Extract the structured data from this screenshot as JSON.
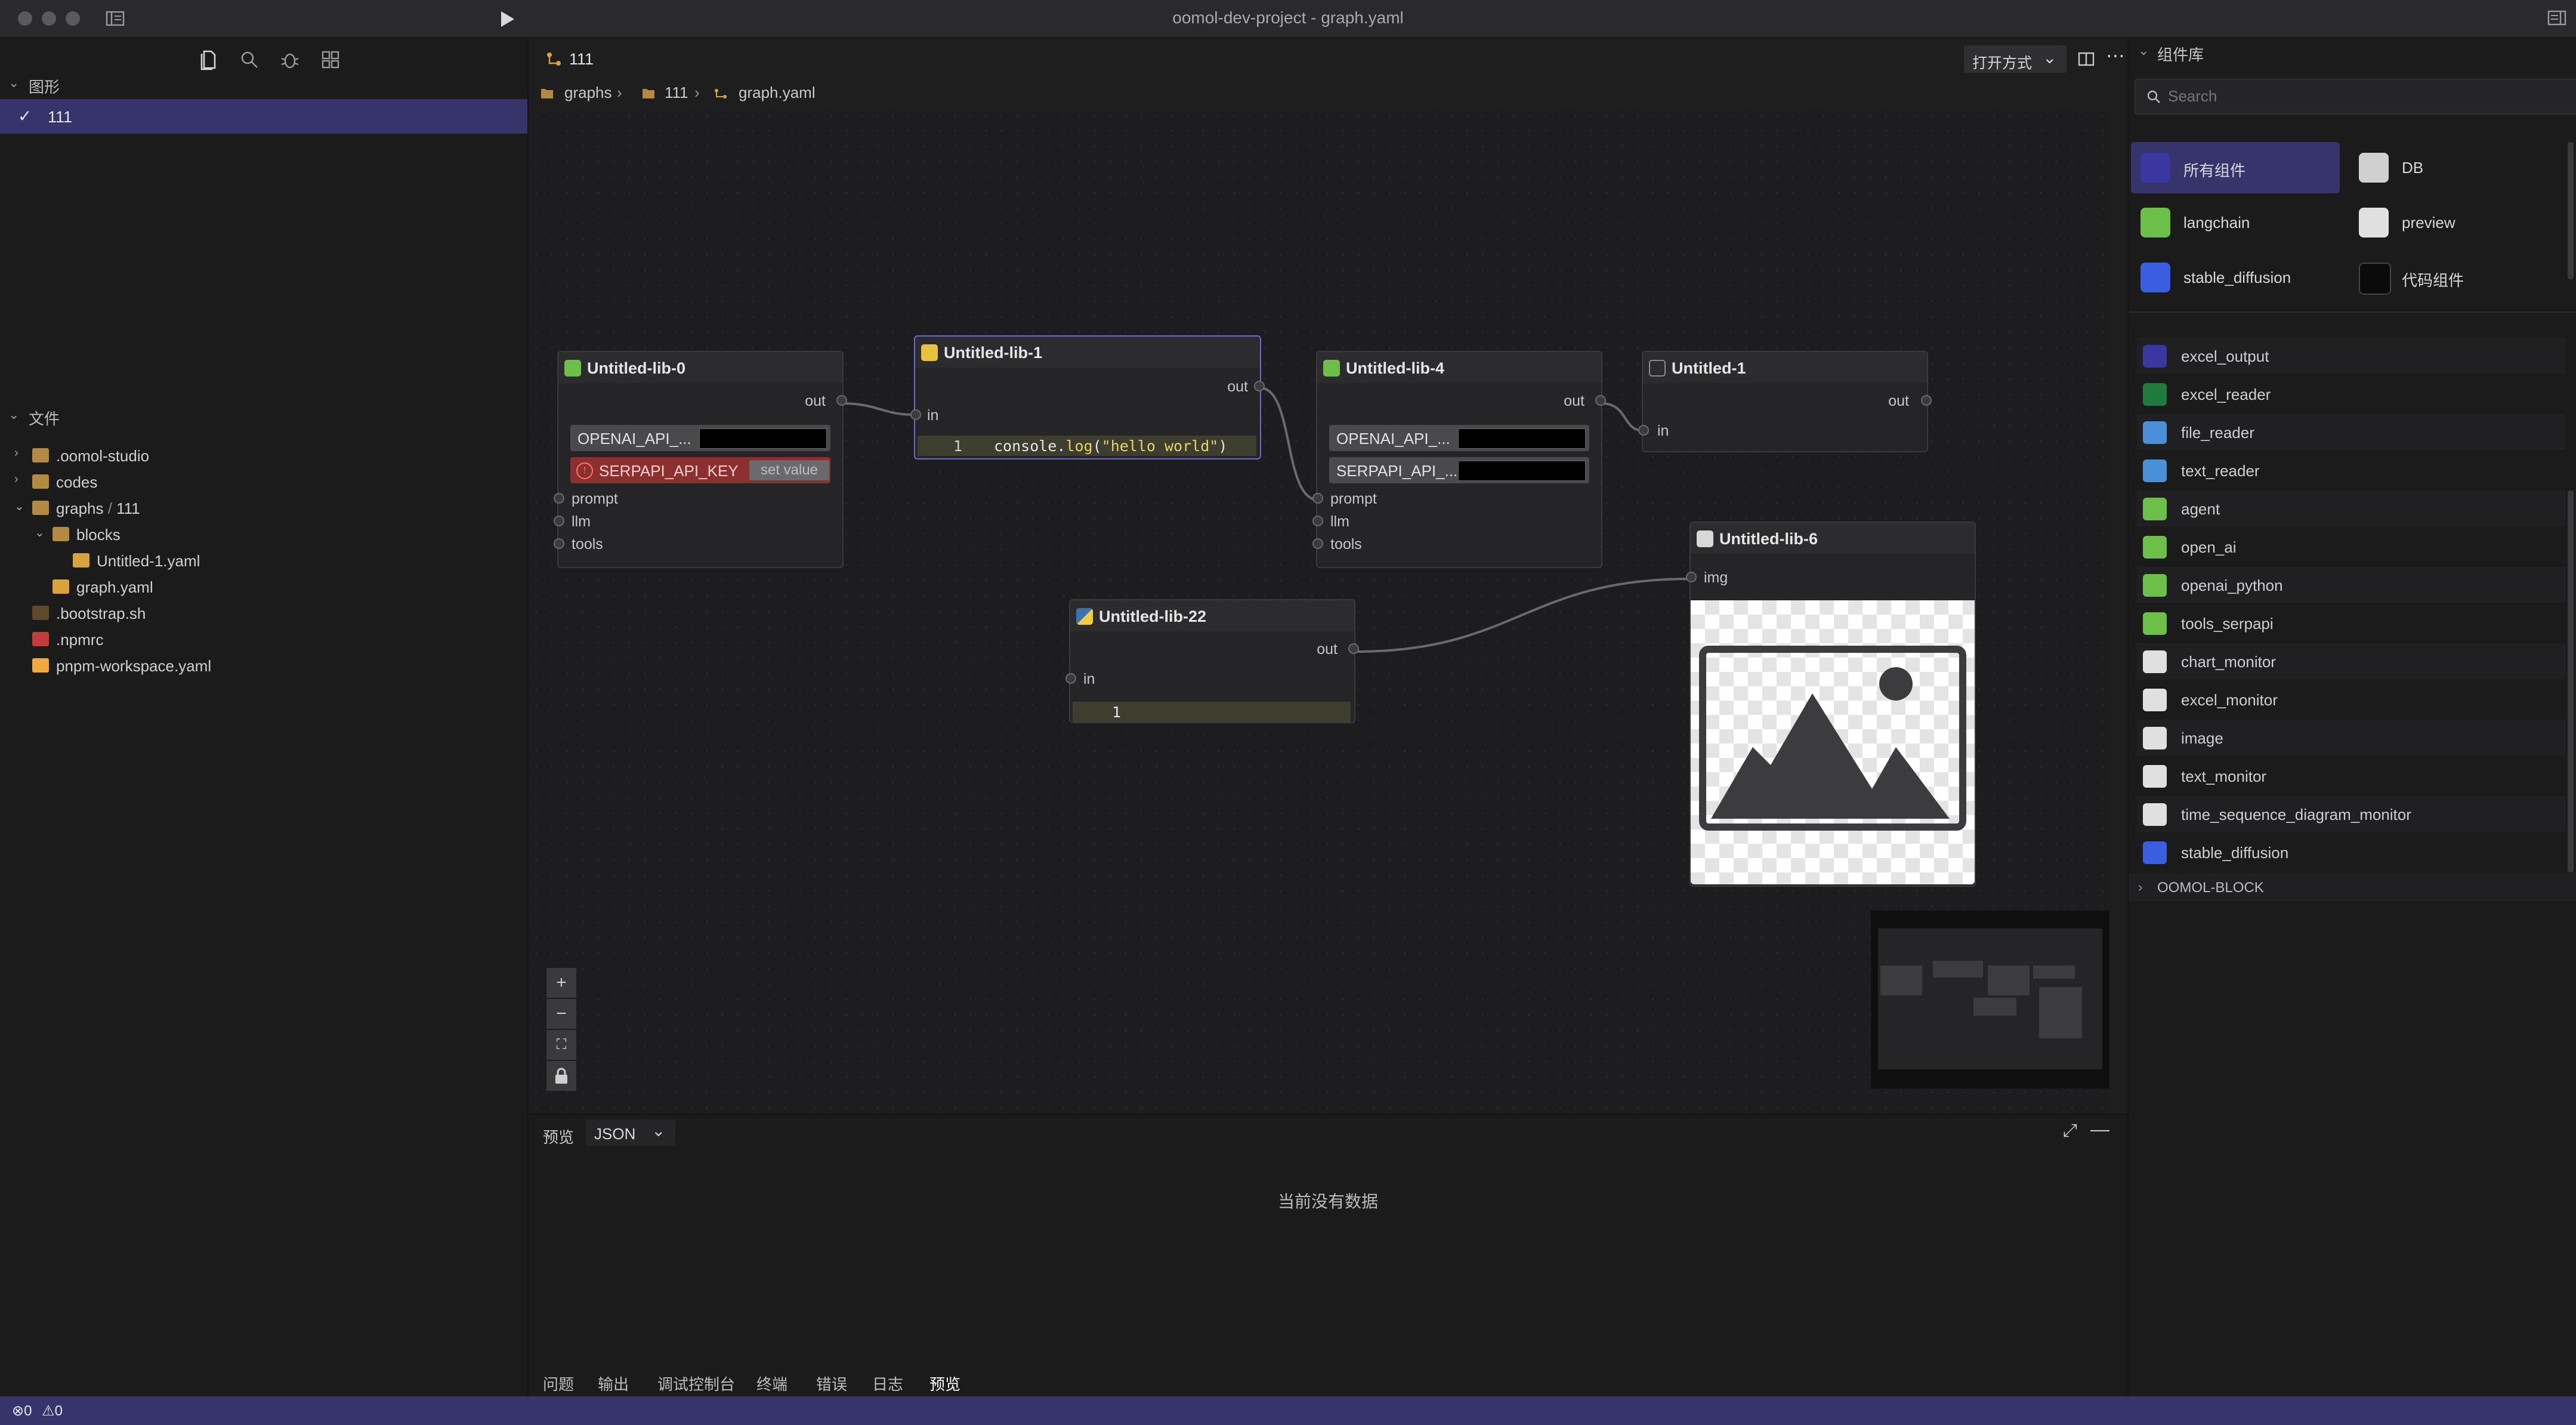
{
  "window": {
    "title": "oomol-dev-project - graph.yaml"
  },
  "left_sidebar": {
    "graphs_section": {
      "title": "图形",
      "items": [
        {
          "label": "111",
          "selected": true
        }
      ]
    },
    "files_section": {
      "title": "文件",
      "tree": [
        {
          "label": ".oomol-studio",
          "indent": 1,
          "arrow": "›",
          "icon": "folder-icon"
        },
        {
          "label": "codes",
          "indent": 1,
          "arrow": "›",
          "icon": "folder-icon"
        },
        {
          "label": "graphs",
          "label2": "111",
          "indent": 1,
          "arrow": "⌄",
          "icon": "folder-open-icon"
        },
        {
          "label": "blocks",
          "indent": 2,
          "arrow": "⌄",
          "icon": "folder-open-icon"
        },
        {
          "label": "Untitled-1.yaml",
          "indent": 3,
          "arrow": "",
          "icon": "yaml-file-icon"
        },
        {
          "label": "graph.yaml",
          "indent": 2,
          "arrow": "",
          "icon": "yaml-file-icon"
        },
        {
          "label": ".bootstrap.sh",
          "indent": 1,
          "arrow": "",
          "icon": "shell-file-icon"
        },
        {
          "label": ".npmrc",
          "indent": 1,
          "arrow": "",
          "icon": "npmrc-file-icon"
        },
        {
          "label": "pnpm-workspace.yaml",
          "indent": 1,
          "arrow": "",
          "icon": "pnpm-file-icon"
        }
      ]
    }
  },
  "editor": {
    "tab_title": "111",
    "open_with_label": "打开方式",
    "breadcrumb": [
      "graphs",
      "111",
      "graph.yaml"
    ]
  },
  "nodes": {
    "lib0": {
      "title": "Untitled-lib-0",
      "out": "out",
      "field1": "OPENAI_API_...",
      "field2": "SERPAPI_API_KEY",
      "field2_action": "set value",
      "inputs": [
        "prompt",
        "llm",
        "tools"
      ]
    },
    "lib1": {
      "title": "Untitled-lib-1",
      "out": "out",
      "in": "in",
      "line_no": "1",
      "code_pre": "console.",
      "code_fn": "log",
      "code_open": "(",
      "code_str": "\"hello world\"",
      "code_close": ")"
    },
    "lib4": {
      "title": "Untitled-lib-4",
      "out": "out",
      "field1": "OPENAI_API_...",
      "field2": "SERPAPI_API_...",
      "inputs": [
        "prompt",
        "llm",
        "tools"
      ]
    },
    "u1": {
      "title": "Untitled-1",
      "out": "out",
      "in": "in"
    },
    "lib6": {
      "title": "Untitled-lib-6",
      "in": "img"
    },
    "lib22": {
      "title": "Untitled-lib-22",
      "out": "out",
      "in": "in",
      "line_no": "1"
    }
  },
  "bottom_panel": {
    "preview_label": "预览",
    "format_select": "JSON",
    "empty_text": "当前没有数据",
    "tabs": [
      "问题",
      "输出",
      "调试控制台",
      "终端",
      "错误",
      "日志",
      "预览"
    ],
    "active_tab": "预览"
  },
  "right_panel": {
    "title": "组件库",
    "search_placeholder": "Search",
    "categories": [
      {
        "label": "所有组件",
        "icon": "all-components-icon",
        "active": true
      },
      {
        "label": "DB",
        "icon": "database-icon"
      },
      {
        "label": "langchain",
        "icon": "langchain-icon"
      },
      {
        "label": "preview",
        "icon": "preview-icon"
      },
      {
        "label": "stable_diffusion",
        "icon": "stable-diffusion-icon"
      },
      {
        "label": "代码组件",
        "icon": "terminal-icon"
      }
    ],
    "components": [
      {
        "label": "excel_output",
        "icon": "excel-output-icon"
      },
      {
        "label": "excel_reader",
        "icon": "excel-icon"
      },
      {
        "label": "file_reader",
        "icon": "folder-icon"
      },
      {
        "label": "text_reader",
        "icon": "folder-icon"
      },
      {
        "label": "agent",
        "icon": "langchain-icon"
      },
      {
        "label": "open_ai",
        "icon": "langchain-icon"
      },
      {
        "label": "openai_python",
        "icon": "langchain-icon"
      },
      {
        "label": "tools_serpapi",
        "icon": "langchain-icon"
      },
      {
        "label": "chart_monitor",
        "icon": "preview-icon"
      },
      {
        "label": "excel_monitor",
        "icon": "preview-icon"
      },
      {
        "label": "image",
        "icon": "preview-icon"
      },
      {
        "label": "text_monitor",
        "icon": "preview-icon"
      },
      {
        "label": "time_sequence_diagram_monitor",
        "icon": "preview-icon"
      },
      {
        "label": "stable_diffusion",
        "icon": "stable-diffusion-icon"
      }
    ],
    "group_label": "OOMOL-BLOCK"
  },
  "status_bar": {
    "errors": "0",
    "warnings": "0"
  },
  "colors": {
    "accent": "#37346b",
    "selection_border": "#6c68d8",
    "error_field": "#8c2f2f"
  }
}
